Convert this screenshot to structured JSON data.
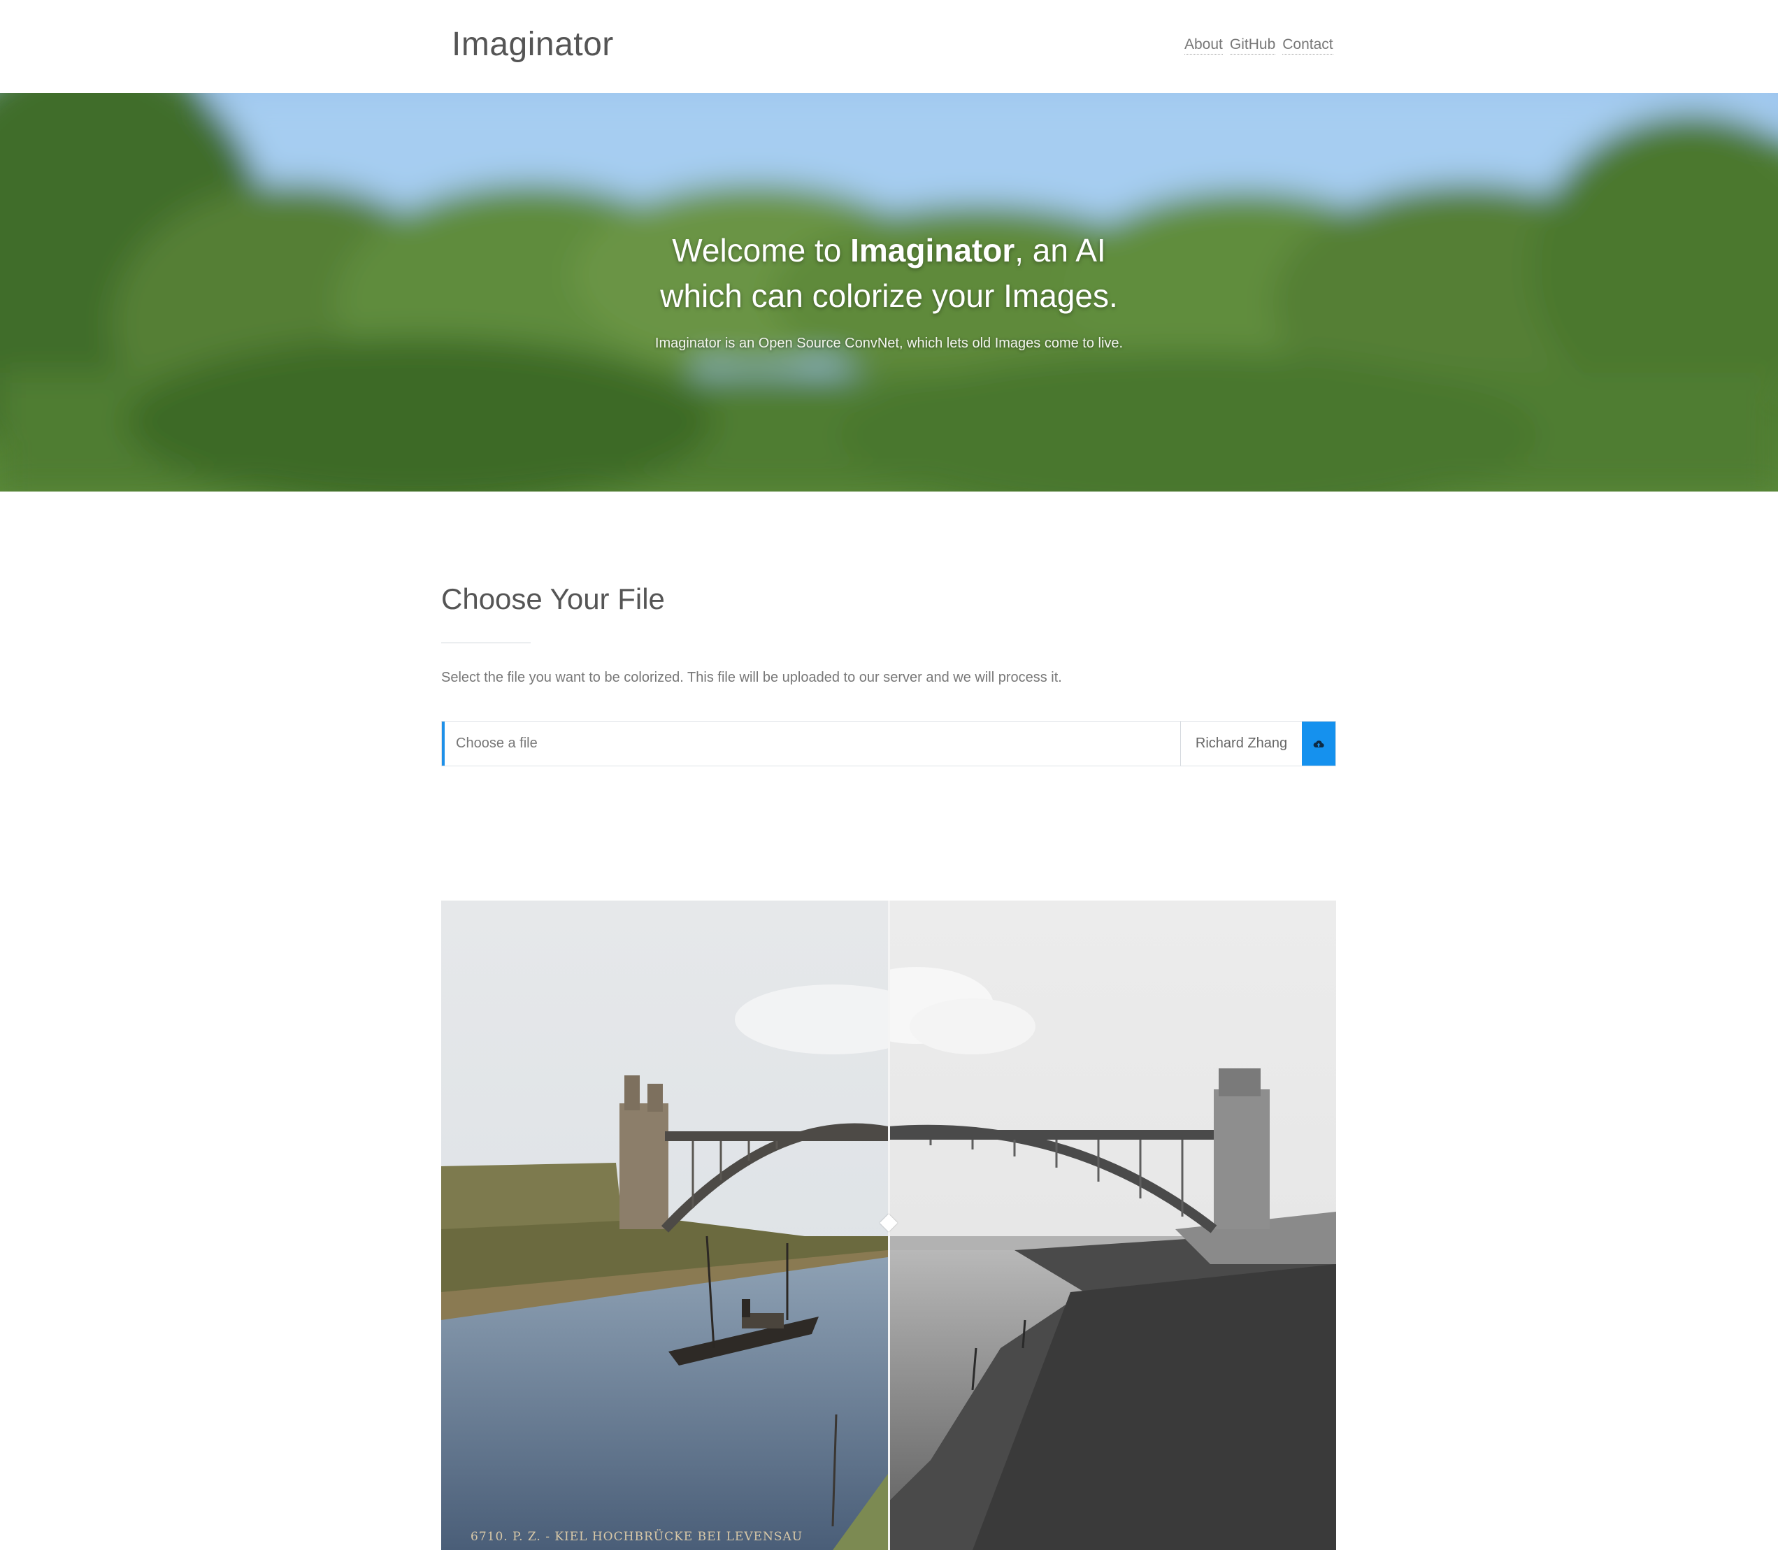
{
  "header": {
    "brand": "Imaginator",
    "nav": [
      "About",
      "GitHub",
      "Contact"
    ]
  },
  "hero": {
    "title_pre": "Welcome to ",
    "title_bold": "Imaginator",
    "title_post": ", an AI",
    "title_line2": "which can colorize your Images.",
    "subtitle": "Imaginator is an Open Source ConvNet, which lets old Images come to live."
  },
  "upload": {
    "title": "Choose Your File",
    "description": "Select the file you want to be colorized. This file will be uploaded to our server and we will process it.",
    "file_placeholder": "Choose a file",
    "model_value": "Richard Zhang",
    "upload_icon": "cloud-upload-icon"
  },
  "compare": {
    "caption": "6710. P. Z. - KIEL HOCHBRÜCKE BEI LEVENSAU",
    "slider_position": 0.5
  },
  "colors": {
    "accent": "#1591ee",
    "text": "#555555"
  }
}
